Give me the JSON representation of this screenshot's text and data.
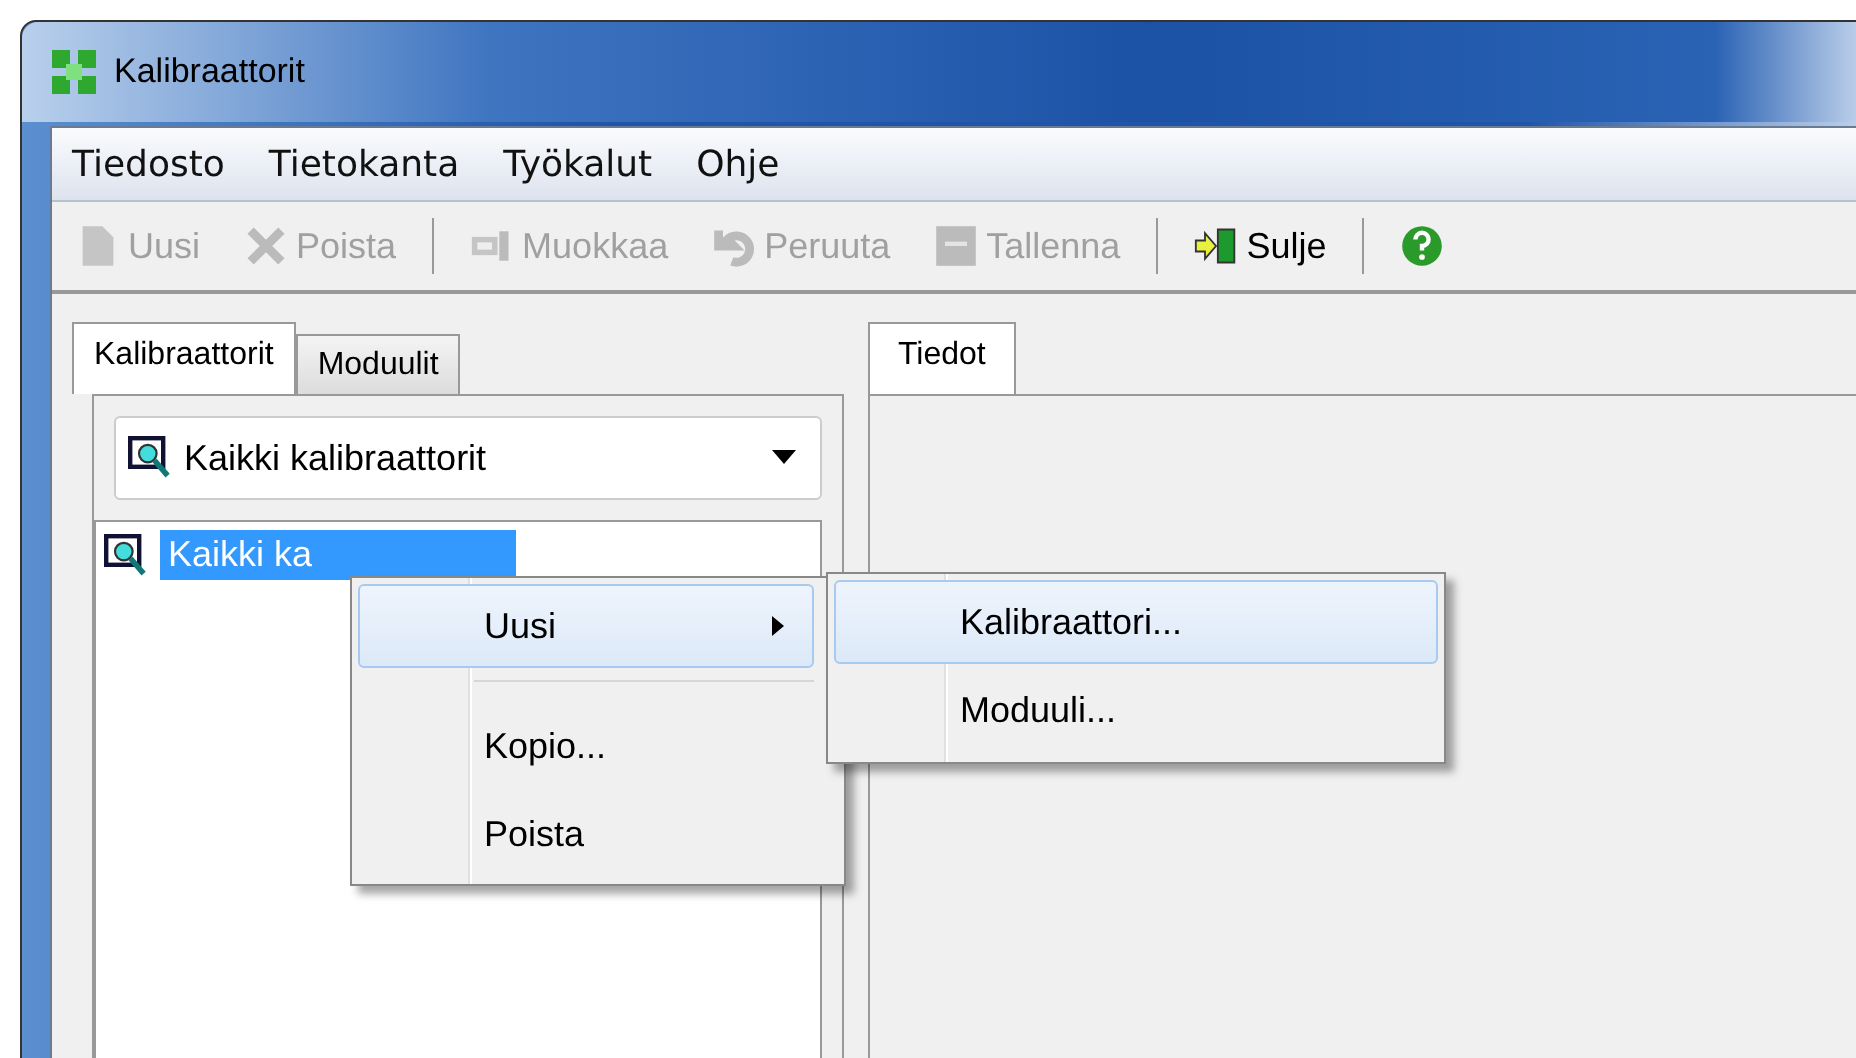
{
  "window": {
    "title": "Kalibraattorit"
  },
  "menu_bar": [
    "Tiedosto",
    "Tietokanta",
    "Työkalut",
    "Ohje"
  ],
  "toolbar": [
    {
      "kind": "new",
      "label": "Uusi",
      "disabled": true
    },
    {
      "kind": "delete",
      "label": "Poista",
      "disabled": true
    },
    {
      "kind": "separator"
    },
    {
      "kind": "edit",
      "label": "Muokkaa",
      "disabled": true
    },
    {
      "kind": "undo",
      "label": "Peruuta",
      "disabled": true
    },
    {
      "kind": "save",
      "label": "Tallenna",
      "disabled": true
    },
    {
      "kind": "separator"
    },
    {
      "kind": "close",
      "label": "Sulje",
      "disabled": false
    },
    {
      "kind": "separator"
    },
    {
      "kind": "help",
      "disabled": false
    }
  ],
  "left_tabs": [
    {
      "label": "Kalibraattorit",
      "selected": true
    },
    {
      "label": "Moduulit",
      "selected": false
    }
  ],
  "filter_dropdown": {
    "value": "Kaikki kalibraattorit"
  },
  "tree": [
    {
      "label": "Kaikki ka",
      "selected": true
    }
  ],
  "right_tabs": [
    {
      "label": "Tiedot",
      "selected": true
    }
  ],
  "context_menu": [
    {
      "kind": "submenu",
      "label": "Uusi",
      "highlighted": true
    },
    {
      "kind": "separator"
    },
    {
      "kind": "item",
      "label": "Kopio...",
      "highlighted": false
    },
    {
      "kind": "item",
      "label": "Poista",
      "highlighted": false
    }
  ],
  "submenu": [
    {
      "label": "Kalibraattori...",
      "highlighted": true
    },
    {
      "label": "Moduuli...",
      "highlighted": false
    }
  ]
}
